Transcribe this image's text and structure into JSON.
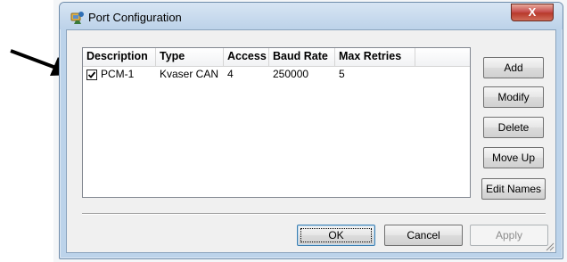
{
  "dialog": {
    "title": "Port Configuration",
    "close_label": "X"
  },
  "list": {
    "columns": [
      "Description",
      "Type",
      "Access",
      "Baud Rate",
      "Max Retries"
    ],
    "rows": [
      {
        "checked": true,
        "description": "PCM-1",
        "type": "Kvaser CAN",
        "access": "4",
        "baud_rate": "250000",
        "max_retries": "5"
      }
    ]
  },
  "side_buttons": {
    "add": "Add",
    "modify": "Modify",
    "delete": "Delete",
    "move_up": "Move Up",
    "edit_names": "Edit Names"
  },
  "footer_buttons": {
    "ok": "OK",
    "cancel": "Cancel",
    "apply": "Apply"
  },
  "colors": {
    "frame": "#bcd3ea",
    "close_button": "#c75050",
    "client": "#f0f0f0"
  }
}
